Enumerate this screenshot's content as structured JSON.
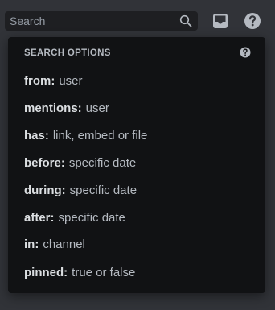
{
  "search": {
    "placeholder": "Search"
  },
  "icons": {
    "search": "search-icon",
    "inbox": "inbox-icon",
    "help": "help-icon"
  },
  "colors": {
    "background": "#313338",
    "popout_background": "#111214",
    "search_background": "#1e1f22",
    "key_text": "#dbdee1",
    "answer_text": "#b5bac1"
  },
  "popout": {
    "header": "SEARCH OPTIONS",
    "options": [
      {
        "key": "from:",
        "answer": "user"
      },
      {
        "key": "mentions:",
        "answer": "user"
      },
      {
        "key": "has:",
        "answer": "link, embed or file"
      },
      {
        "key": "before:",
        "answer": "specific date"
      },
      {
        "key": "during:",
        "answer": "specific date"
      },
      {
        "key": "after:",
        "answer": "specific date"
      },
      {
        "key": "in:",
        "answer": "channel"
      },
      {
        "key": "pinned:",
        "answer": "true or false"
      }
    ]
  }
}
